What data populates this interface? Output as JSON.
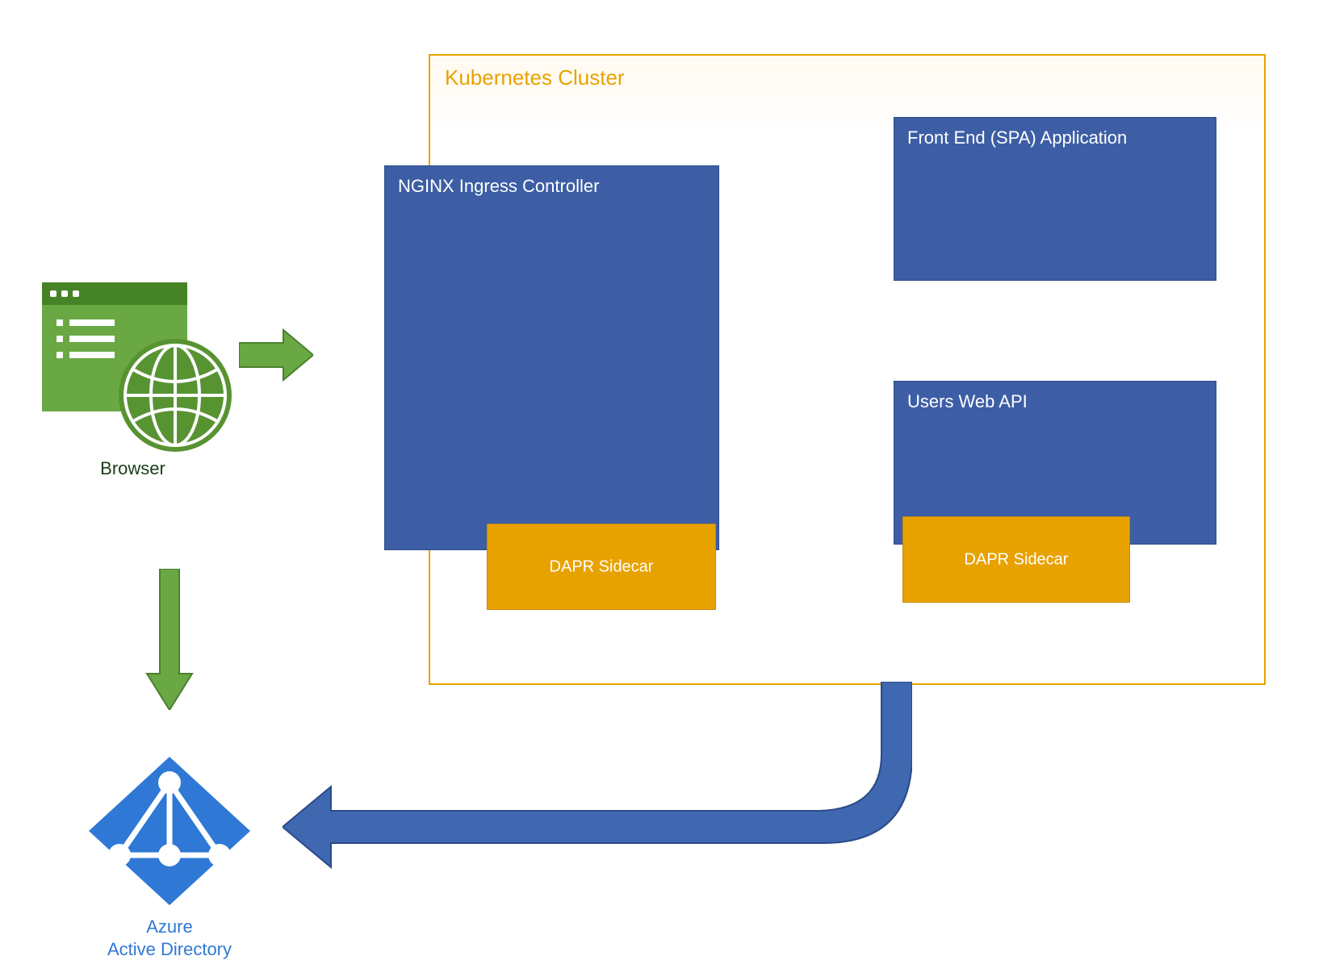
{
  "browser": {
    "label": "Browser"
  },
  "azure_ad": {
    "title_line1": "Azure",
    "title_line2": "Active Directory"
  },
  "cluster": {
    "title": "Kubernetes Cluster",
    "nginx_label": "NGINX Ingress Controller",
    "spa_label": "Front End (SPA) Application",
    "api_label": "Users Web API",
    "dapr_label": "DAPR Sidecar"
  },
  "colors": {
    "green_fill": "#6aa844",
    "green_stroke": "#4a8030",
    "blue_box": "#3d5ea5",
    "blue_arrow_fill": "#3f68b0",
    "blue_arrow_stroke": "#2b4a8a",
    "gold": "#e8a200",
    "aad_blue": "#2f78d6"
  }
}
